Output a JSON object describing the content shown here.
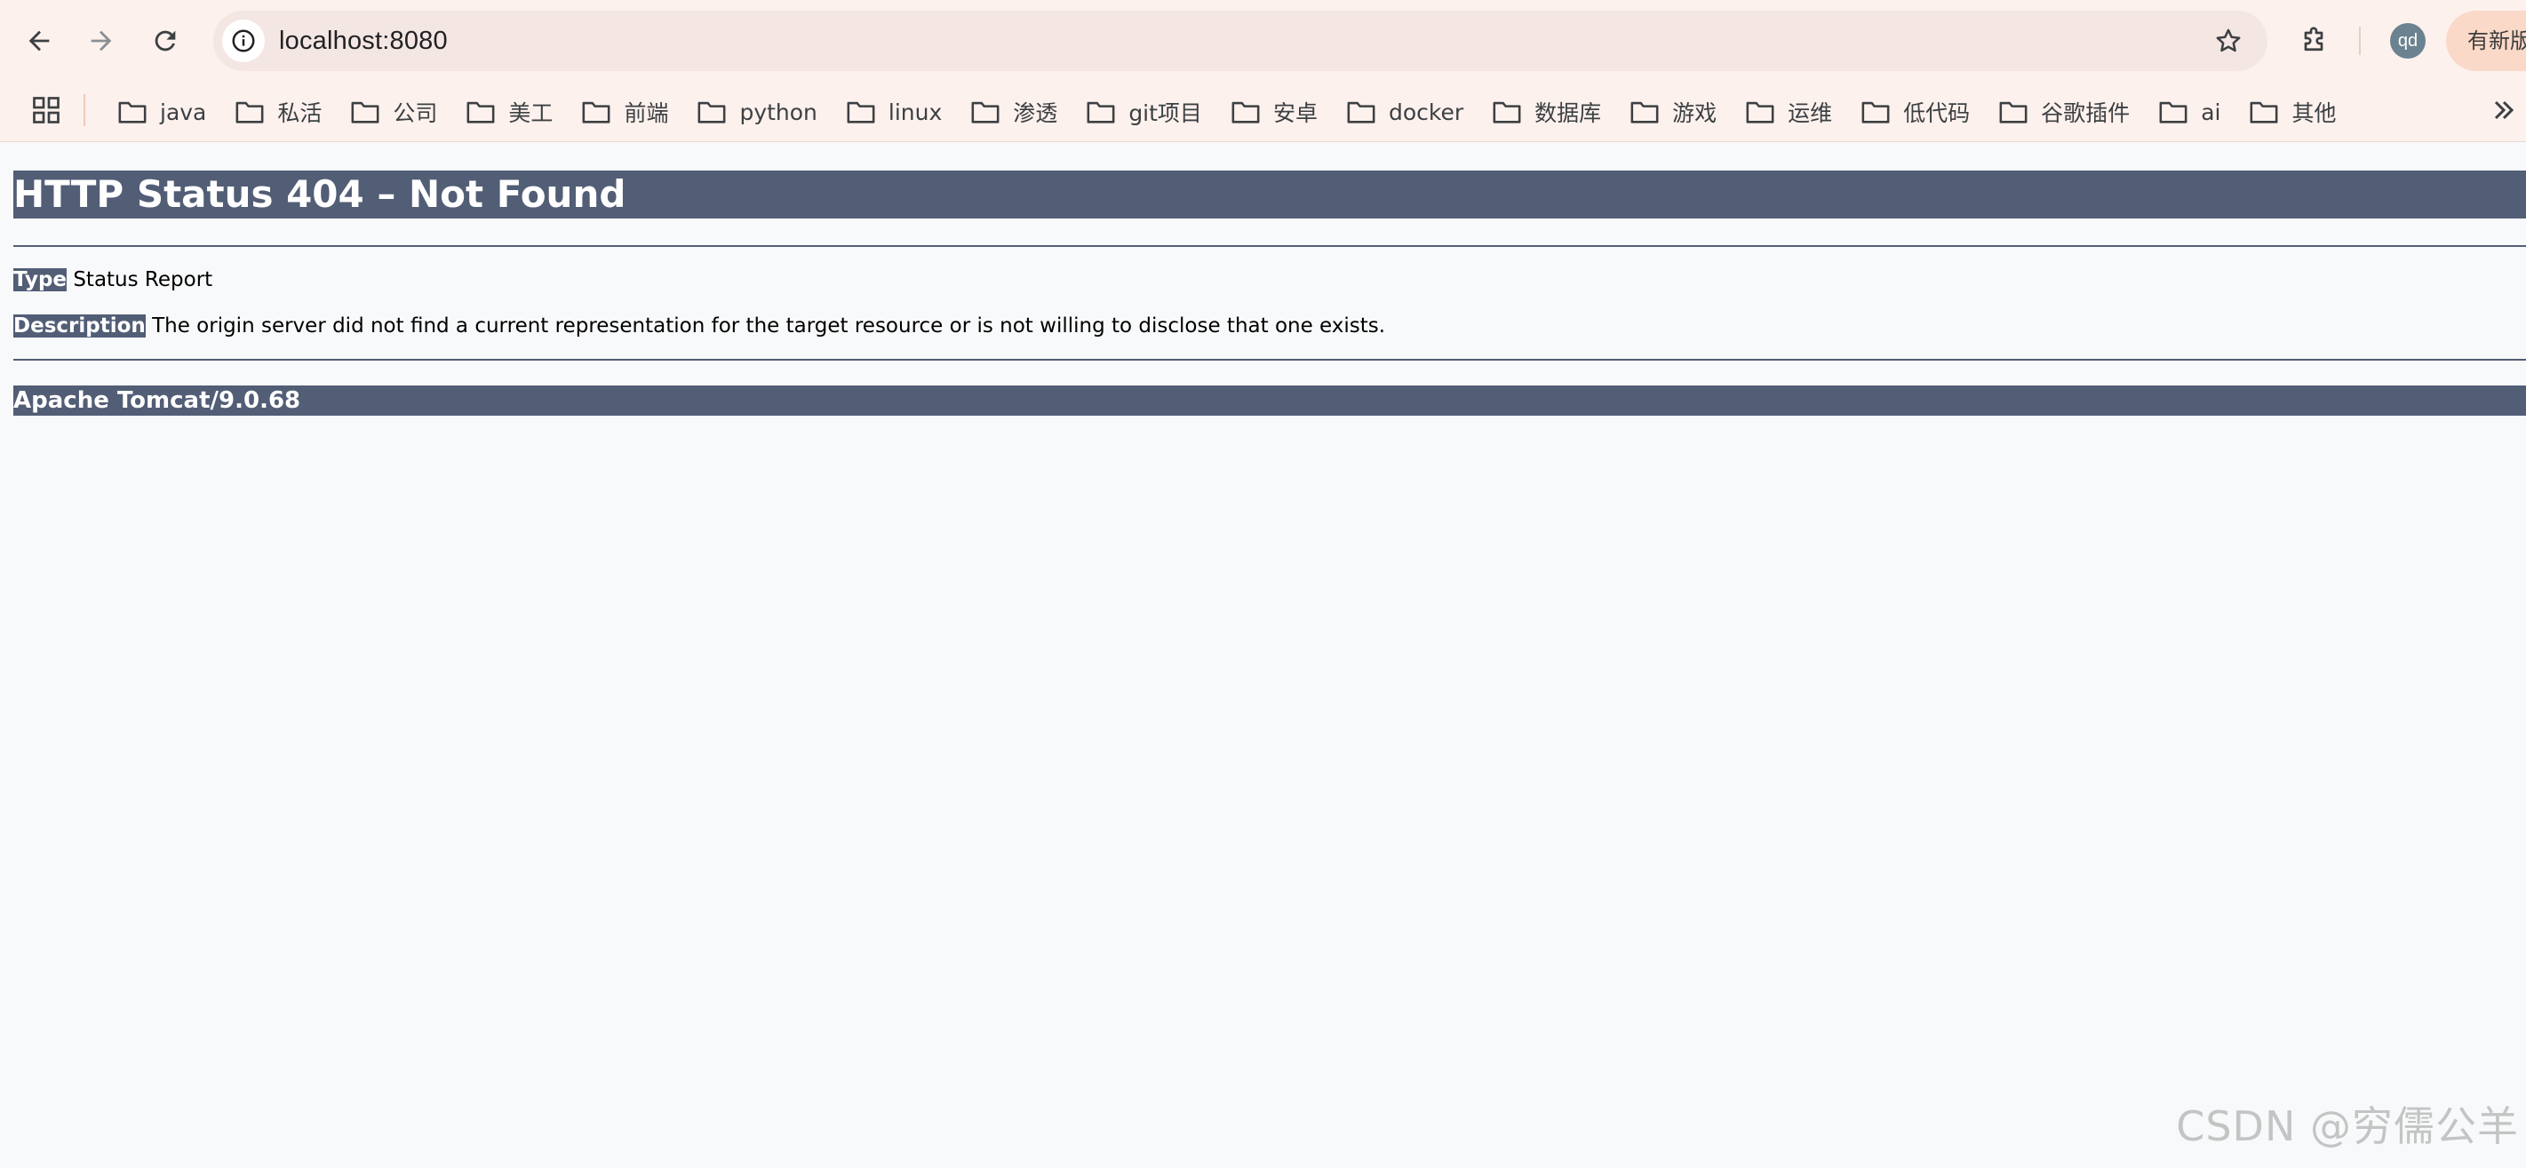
{
  "browser": {
    "url": "localhost:8080",
    "profile_initials": "qd",
    "update_label": "有新版",
    "icons": {
      "back": "back-arrow-icon",
      "forward": "forward-arrow-icon",
      "reload": "reload-icon",
      "site_info": "info-icon",
      "bookmark_star": "star-icon",
      "extensions": "puzzle-icon",
      "apps": "apps-grid-icon",
      "more_bookmarks": "double-chevron-icon"
    }
  },
  "bookmarks": [
    {
      "label": "java"
    },
    {
      "label": "私活"
    },
    {
      "label": "公司"
    },
    {
      "label": "美工"
    },
    {
      "label": "前端"
    },
    {
      "label": "python"
    },
    {
      "label": "linux"
    },
    {
      "label": "渗透"
    },
    {
      "label": "git项目"
    },
    {
      "label": "安卓"
    },
    {
      "label": "docker"
    },
    {
      "label": "数据库"
    },
    {
      "label": "游戏"
    },
    {
      "label": "运维"
    },
    {
      "label": "低代码"
    },
    {
      "label": "谷歌插件"
    },
    {
      "label": "ai"
    },
    {
      "label": "其他"
    }
  ],
  "error_page": {
    "title": "HTTP Status 404 – Not Found",
    "type_label": "Type",
    "type_value": "Status Report",
    "description_label": "Description",
    "description_value": "The origin server did not find a current representation for the target resource or is not willing to disclose that one exists.",
    "server_info": "Apache Tomcat/9.0.68"
  },
  "watermark": "CSDN @穷儒公羊",
  "colors": {
    "chrome_bg": "#fdf1ed",
    "omnibox_bg": "#f4e6e2",
    "tomcat_header": "#525d76",
    "page_bg": "#f8f9fa",
    "update_button": "#fbd9c9"
  }
}
